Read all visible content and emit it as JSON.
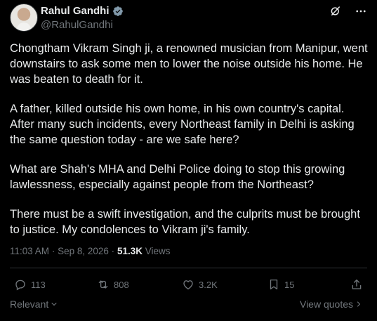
{
  "author": {
    "name": "Rahul Gandhi",
    "handle": "@RahulGandhi",
    "verified": true
  },
  "header_icons": [
    "grok-icon",
    "more-icon"
  ],
  "post": {
    "paragraphs": [
      "Chongtham Vikram Singh ji, a renowned musician from Manipur, went downstairs to ask some men to lower the noise outside his home. He was beaten to death for it.",
      "A father, killed outside his own home, in his own country's capital. After many such incidents, every Northeast family in Delhi is asking the same question today - are we safe here?",
      "What are Shah's MHA and Delhi Police doing to stop this growing lawlessness, especially against people from the Northeast?",
      "There must be a swift investigation, and the culprits must be brought to justice. My condolences to Vikram ji's family."
    ],
    "time": "11:03 AM",
    "separator": "·",
    "date": "Sep 8, 2026",
    "views_count": "51.3K",
    "views_label": "Views"
  },
  "actions": {
    "replies": "113",
    "reposts": "808",
    "likes": "3.2K",
    "bookmarks": "15"
  },
  "footer": {
    "sort_label": "Relevant",
    "view_quotes_label": "View quotes"
  },
  "colors": {
    "background": "#000000",
    "text": "#e7e9ea",
    "muted": "#71767b",
    "verified": "#829aab"
  }
}
